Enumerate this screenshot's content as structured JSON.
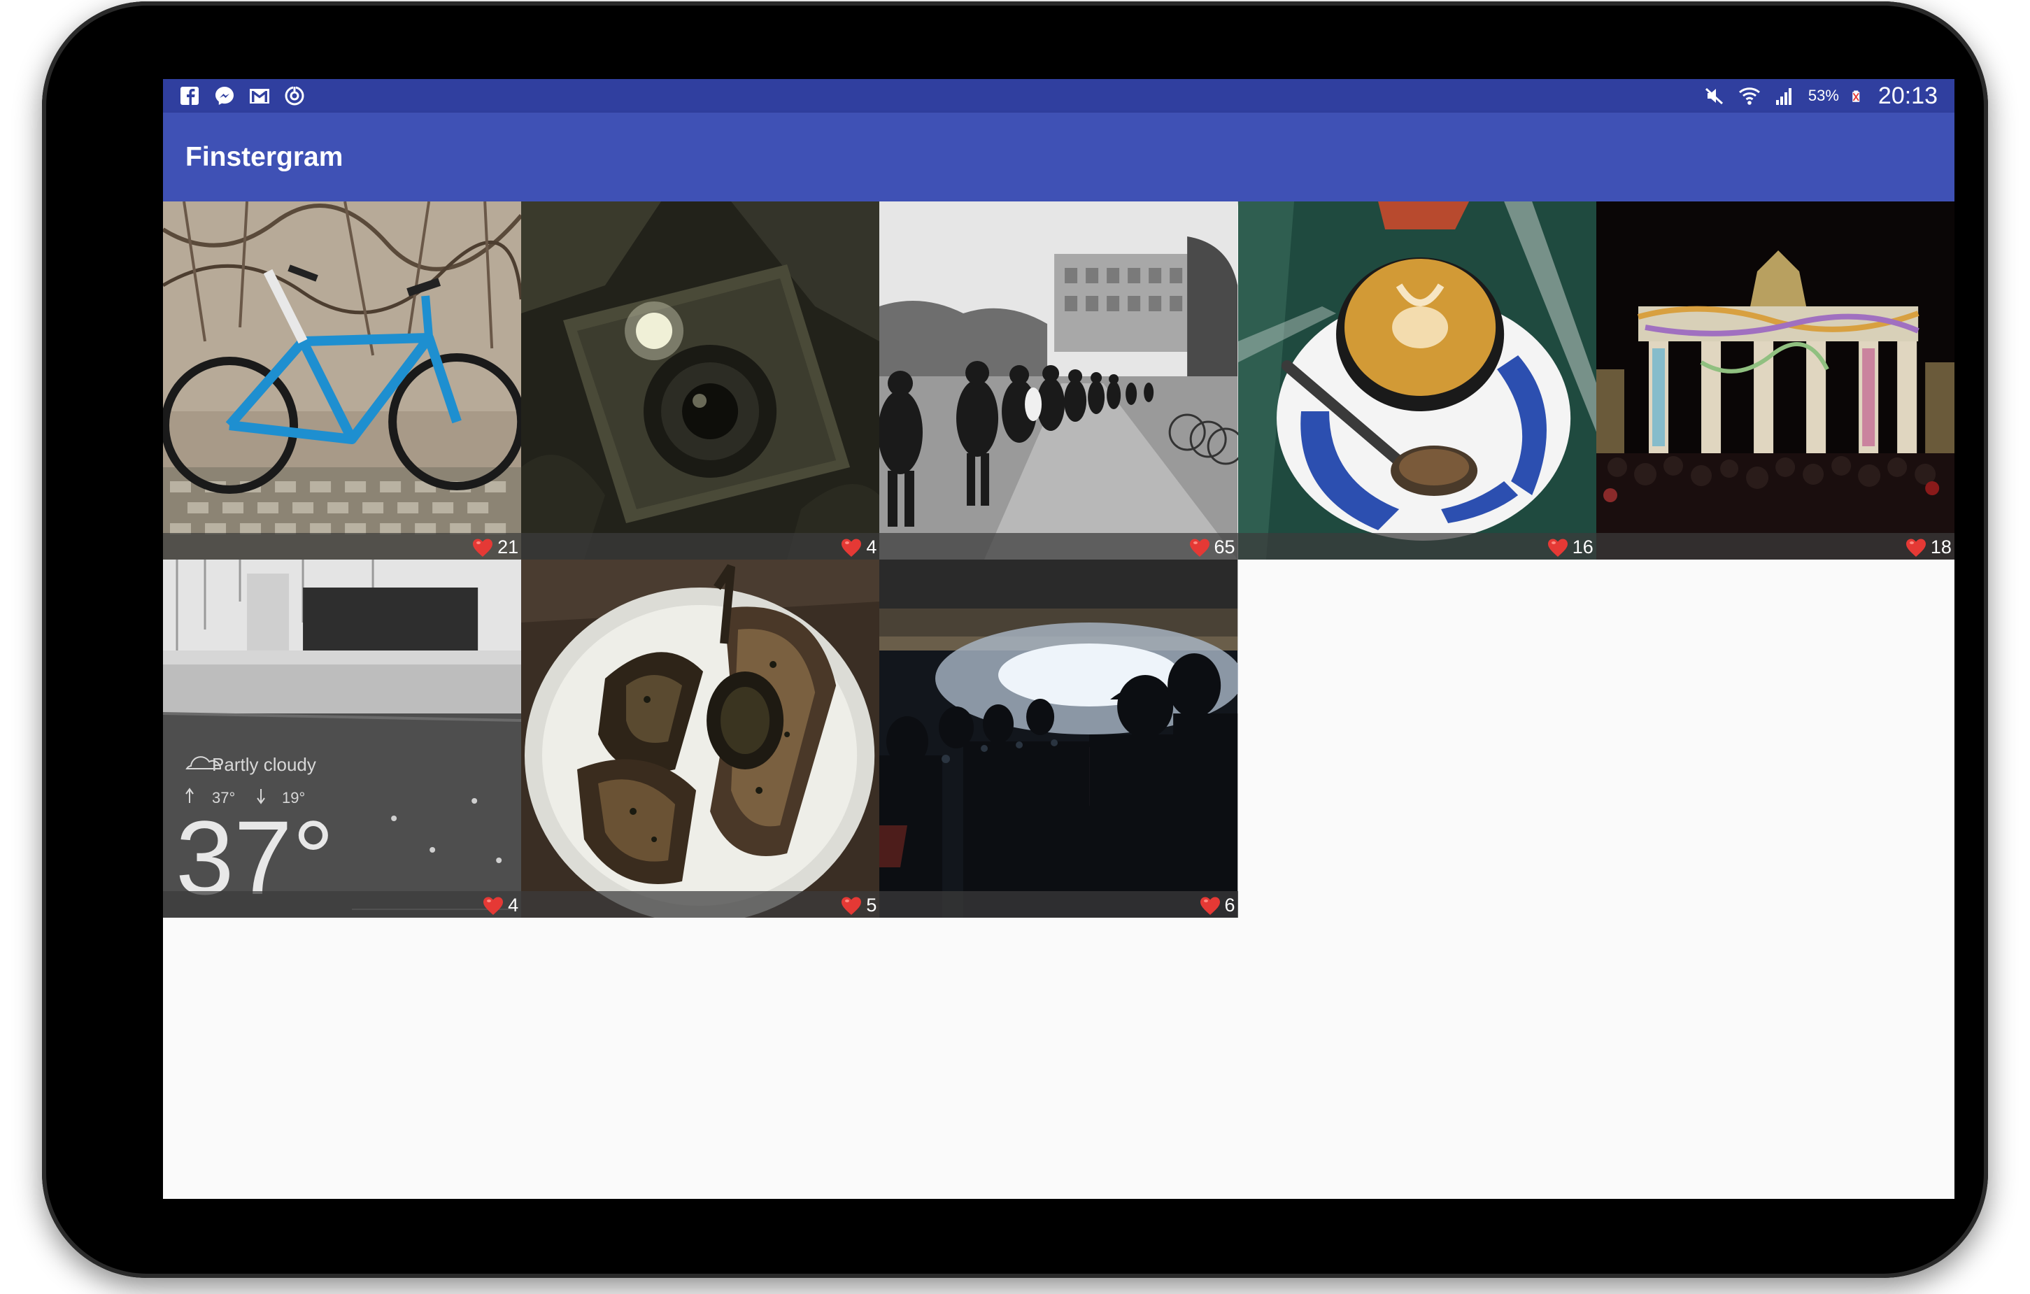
{
  "status_bar": {
    "left_icons": [
      "facebook-icon",
      "messenger-icon",
      "gmail-icon",
      "sync-icon"
    ],
    "right_icons": [
      "mute-icon",
      "wifi-icon",
      "signal-icon",
      "battery-icon"
    ],
    "battery": "53%",
    "time": "20:13"
  },
  "app_bar": {
    "title": "Finstergram"
  },
  "colors": {
    "status_bar": "#303f9f",
    "app_bar": "#3f51b5",
    "background": "#fafafa",
    "heart": "#e53935"
  },
  "photos": [
    {
      "subject": "bicycle",
      "likes": "21"
    },
    {
      "subject": "camera",
      "likes": "4"
    },
    {
      "subject": "queue",
      "likes": "65"
    },
    {
      "subject": "coffee",
      "likes": "16"
    },
    {
      "subject": "gate",
      "likes": "18"
    },
    {
      "subject": "weather",
      "likes": "4",
      "weather_text": {
        "condition": "Partly cloudy",
        "high": "37°",
        "low": "19°",
        "temp": "37°"
      }
    },
    {
      "subject": "food",
      "likes": "5"
    },
    {
      "subject": "concert",
      "likes": "6"
    }
  ]
}
